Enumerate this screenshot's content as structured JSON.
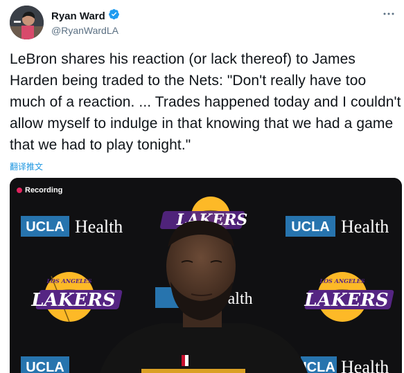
{
  "author": {
    "display_name": "Ryan Ward",
    "handle": "@RyanWardLA",
    "verified": true
  },
  "tweet": {
    "text": "LeBron shares his reaction (or lack thereof) to James Harden being traded to the Nets: \"Don't really have too much of a reaction. ... Trades happened today and I couldn't allow myself to indulge in that knowing that we had a game that we had to play tonight.\"",
    "translate_label": "翻译推文"
  },
  "media": {
    "recording_label": "Recording",
    "backdrop": {
      "sponsor_brand": "UCLA",
      "sponsor_word": "Health",
      "sponsor_word_partial": "ealth",
      "team_logo_top": "LOS ANGELES",
      "team_logo_main": "LAKERS"
    }
  },
  "colors": {
    "accent_blue": "#1d9bf0",
    "text_primary": "#0f1419",
    "text_secondary": "#5b7083",
    "lakers_gold": "#fdb927",
    "lakers_purple": "#552583",
    "ucla_blue": "#2774ae"
  },
  "icons": {
    "verified": "verified-badge-icon",
    "menu": "more-options-icon",
    "recording": "recording-dot-icon"
  }
}
